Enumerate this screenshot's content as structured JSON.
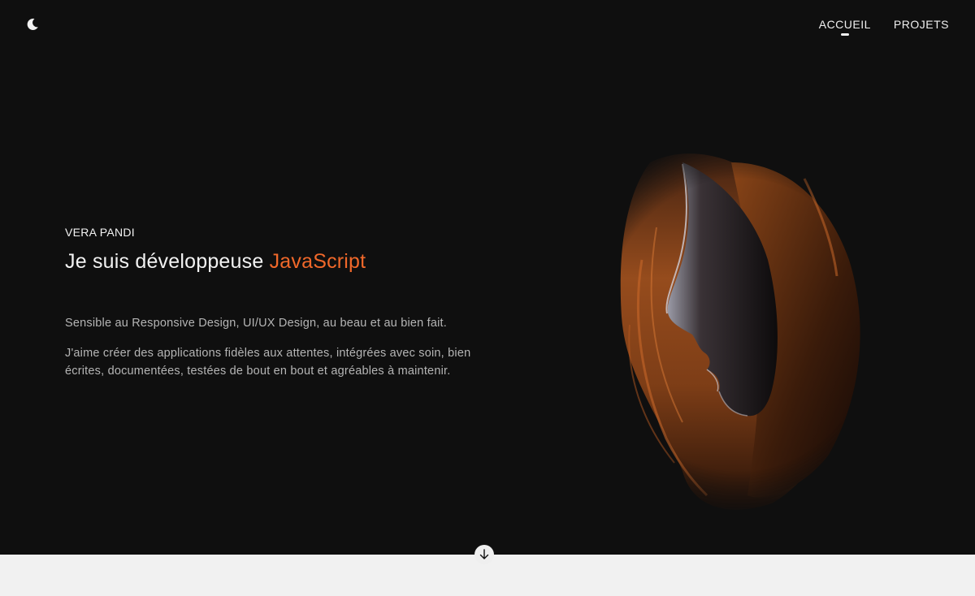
{
  "header": {
    "theme_toggle_icon": "crescent-moon-icon",
    "nav": [
      {
        "label": "ACCUEIL",
        "active": true
      },
      {
        "label": "PROJETS",
        "active": false
      }
    ]
  },
  "hero": {
    "name": "VERA PANDI",
    "title_prefix": "Je suis développeuse ",
    "title_accent": "JavaScript",
    "paragraph_1": "Sensible au Responsive Design, UI/UX Design, au beau et au bien fait.",
    "paragraph_2": "J'aime créer des applications fidèles aux attentes, intégrées avec soin, bien écrites, documentées, testées de bout en bout et agréables à maintenir.",
    "portrait": "woman-profile-portrait"
  },
  "scroll_down_icon": "arrow-down-icon",
  "colors": {
    "background": "#0f0f0f",
    "accent": "#f0682a",
    "text": "#f2f2f2",
    "muted_text": "#b5b5b5",
    "lower_section": "#f1f1f1"
  }
}
